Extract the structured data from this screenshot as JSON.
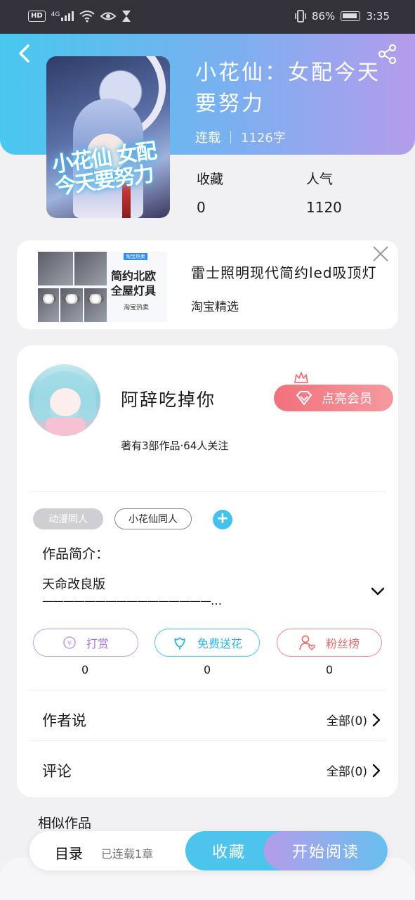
{
  "status_bar": {
    "left": {
      "hd": "HD",
      "network": "4G"
    },
    "right": {
      "battery": "86%",
      "time": "3:35"
    }
  },
  "header": {
    "back_icon": "chevron-left-icon",
    "share_icon": "share-icon",
    "book_title": "小花仙：女配今天要努力",
    "status": "连载",
    "word_count": "1126字",
    "cover_text": "小花仙 女配今天要努力",
    "stats": [
      {
        "label": "收藏",
        "value": "0"
      },
      {
        "label": "人气",
        "value": "1120"
      }
    ]
  },
  "ad": {
    "image_headline": "简约北欧\n全屋灯具",
    "image_tag": "淘宝热卖",
    "image_caption": "淘宝热卖",
    "title": "雷士照明现代简约led吸顶灯",
    "source": "淘宝精选",
    "close_icon": "close-icon"
  },
  "author": {
    "name": "阿辞吃掉你",
    "stats": "著有3部作品·64人关注",
    "vip_button": "点亮会员"
  },
  "tags": [
    "动漫同人",
    "小花仙同人"
  ],
  "intro": {
    "label": "作品简介：",
    "text": "天命改良版",
    "more": "————————————————…"
  },
  "actions": [
    {
      "label": "打赏",
      "count": "0",
      "icon": "coin-icon"
    },
    {
      "label": "免费送花",
      "count": "0",
      "icon": "flower-icon"
    },
    {
      "label": "粉丝榜",
      "count": "0",
      "icon": "fan-user-icon"
    }
  ],
  "rows": [
    {
      "label": "作者说",
      "right": "全部(0)"
    },
    {
      "label": "评论",
      "right": "全部(0)"
    }
  ],
  "similar_title": "相似作品",
  "bottom_bar": {
    "toc": "目录",
    "status": "已连载1章",
    "favorite": "收藏",
    "start_reading": "开始阅读"
  }
}
